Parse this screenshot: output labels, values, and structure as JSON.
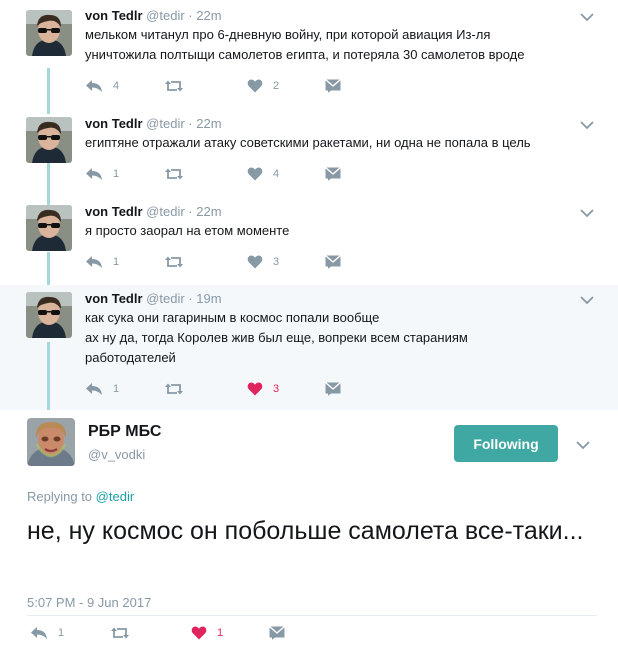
{
  "thread": [
    {
      "name": "von Tedlr",
      "handle": "@tedir",
      "sep": "·",
      "time": "22m",
      "lines": [
        "мельком читанул про 6-дневную войну, при которой авиация Из-ля",
        "уничтожила полтыщи самолетов египта, и потеряла 30 самолетов вроде"
      ],
      "replies": "4",
      "retweets": "",
      "likes": "2",
      "liked": false
    },
    {
      "name": "von Tedlr",
      "handle": "@tedir",
      "sep": "·",
      "time": "22m",
      "lines": [
        "египтяне отражали атаку советскими ракетами, ни одна не попала в цель"
      ],
      "replies": "1",
      "retweets": "",
      "likes": "4",
      "liked": false
    },
    {
      "name": "von Tedlr",
      "handle": "@tedir",
      "sep": "·",
      "time": "22m",
      "lines": [
        "я просто заорал на етом моменте"
      ],
      "replies": "1",
      "retweets": "",
      "likes": "3",
      "liked": false
    },
    {
      "name": "von Tedlr",
      "handle": "@tedir",
      "sep": "·",
      "time": "19m",
      "lines": [
        "как сука они гагариным в космос попали вообще",
        "ах ну да, тогда Королев жив был еще, вопреки всем стараниям",
        "работодателей"
      ],
      "replies": "1",
      "retweets": "",
      "likes": "3",
      "liked": true
    }
  ],
  "main_tweet": {
    "name": "РБР МБС",
    "handle": "@v_vodki",
    "follow_label": "Following",
    "replying_prefix": "Replying to",
    "replying_to": "@tedir",
    "text": "не, ну космос он побольше самолета все-таки...",
    "date": "5:07 PM - 9 Jun 2017",
    "replies": "1",
    "retweets": "",
    "likes": "1",
    "liked": true
  },
  "icons": {
    "reply": "reply-icon",
    "retweet": "retweet-icon",
    "like": "heart-icon",
    "dm": "envelope-icon",
    "caret": "chevron-down-icon"
  },
  "colors": {
    "accent": "#3fa8a3",
    "muted": "#8899a6",
    "liked": "#e0245e",
    "thread_line": "#a3d8dc",
    "highlight_bg": "#f5f8fa"
  }
}
